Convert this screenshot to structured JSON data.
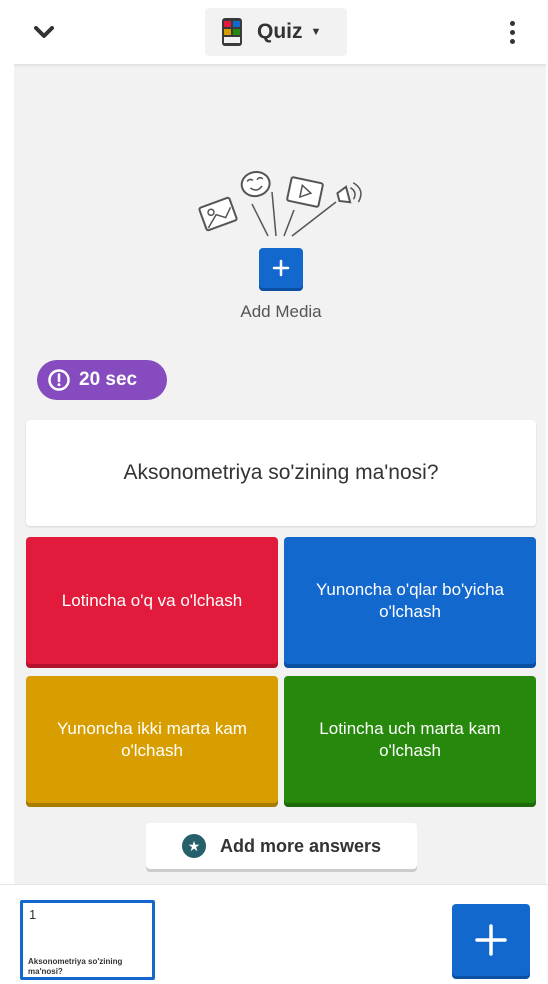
{
  "header": {
    "question_type": "Quiz",
    "icons": {
      "collapse": "chevron-down-icon",
      "type": "quiz-type-icon",
      "caret": "caret-down-icon",
      "more": "more-vertical-icon"
    }
  },
  "media": {
    "label": "Add Media",
    "button_icon": "plus-icon"
  },
  "timer": {
    "label": "20 sec",
    "icon": "clock-icon"
  },
  "question": {
    "text": "Aksonometriya so'zining ma'nosi?"
  },
  "answers": [
    {
      "text": "Lotincha o'q va o'lchash",
      "color": "#e21b3c"
    },
    {
      "text": "Yunoncha o'qlar bo'yicha o'lchash",
      "color": "#1368ce"
    },
    {
      "text": "Yunoncha ikki marta kam o'lchash",
      "color": "#d89e00"
    },
    {
      "text": "Lotincha uch marta kam o'lchash",
      "color": "#26890c"
    }
  ],
  "add_more": {
    "label": "Add more answers",
    "icon": "star-icon"
  },
  "slides": [
    {
      "number": "1",
      "title": "Aksonometriya so'zining ma'nosi?"
    }
  ],
  "add_slide": {
    "icon": "plus-icon"
  },
  "colors": {
    "accent": "#1368ce",
    "timer": "#864cbf"
  }
}
